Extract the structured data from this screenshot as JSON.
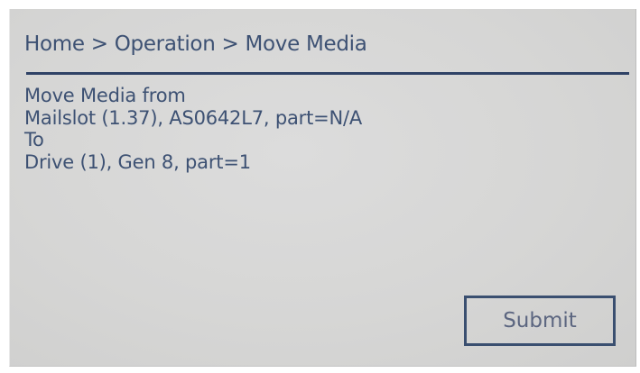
{
  "header": {
    "breadcrumb": "Home > Operation > Move Media"
  },
  "main": {
    "lines": [
      "Move Media from",
      "Mailslot (1.37), AS0642L7, part=N/A",
      "To",
      "Drive (1), Gen 8, part=1"
    ]
  },
  "actions": {
    "submit_label": "Submit"
  },
  "colors": {
    "text": "#3d5173",
    "rule": "#2f4266",
    "screen_background": "#d6d6d5"
  }
}
